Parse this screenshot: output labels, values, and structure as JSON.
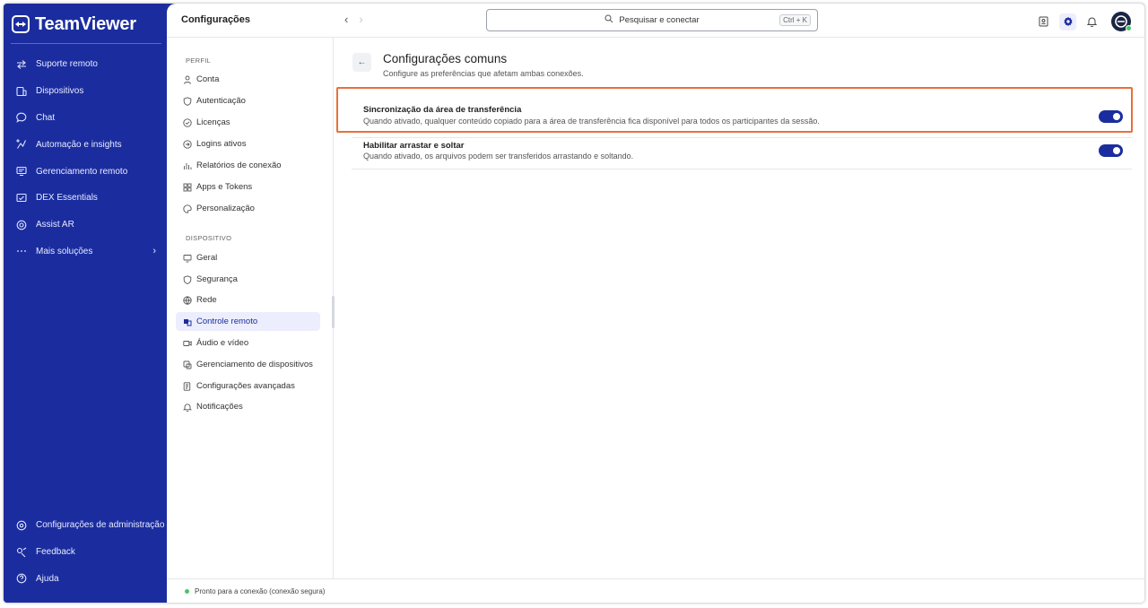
{
  "brand": {
    "name": "TeamViewer"
  },
  "sidebar": {
    "items": [
      {
        "label": "Suporte remoto",
        "icon": "arrows-swap-icon"
      },
      {
        "label": "Dispositivos",
        "icon": "devices-icon"
      },
      {
        "label": "Chat",
        "icon": "chat-icon"
      },
      {
        "label": "Automação e insights",
        "icon": "automation-icon"
      },
      {
        "label": "Gerenciamento remoto",
        "icon": "remote-management-icon"
      },
      {
        "label": "DEX Essentials",
        "icon": "dex-icon"
      },
      {
        "label": "Assist AR",
        "icon": "assist-ar-icon"
      },
      {
        "label": "Mais soluções",
        "icon": "more-dots-icon"
      }
    ],
    "bottom": [
      {
        "label": "Configurações de administração",
        "icon": "admin-settings-icon"
      },
      {
        "label": "Feedback",
        "icon": "feedback-icon"
      },
      {
        "label": "Ajuda",
        "icon": "help-icon"
      }
    ]
  },
  "header": {
    "title": "Configurações",
    "search_placeholder": "Pesquisar e conectar",
    "search_shortcut": "Ctrl + K"
  },
  "settings_nav": {
    "profile_label": "PERFIL",
    "profile_items": [
      {
        "label": "Conta",
        "icon": "user-icon"
      },
      {
        "label": "Autenticação",
        "icon": "shield-icon"
      },
      {
        "label": "Licenças",
        "icon": "check-circle-icon"
      },
      {
        "label": "Logins ativos",
        "icon": "login-icon"
      },
      {
        "label": "Relatórios de conexão",
        "icon": "bar-chart-icon"
      },
      {
        "label": "Apps e Tokens",
        "icon": "apps-icon"
      },
      {
        "label": "Personalização",
        "icon": "palette-icon"
      }
    ],
    "device_label": "DISPOSITIVO",
    "device_items": [
      {
        "label": "Geral",
        "icon": "monitor-icon"
      },
      {
        "label": "Segurança",
        "icon": "shield-icon"
      },
      {
        "label": "Rede",
        "icon": "globe-icon"
      },
      {
        "label": "Controle remoto",
        "icon": "remote-control-icon",
        "active": true
      },
      {
        "label": "Áudio e vídeo",
        "icon": "video-camera-icon"
      },
      {
        "label": "Gerenciamento de dispositivos",
        "icon": "device-management-icon"
      },
      {
        "label": "Configurações avançadas",
        "icon": "advanced-settings-icon"
      },
      {
        "label": "Notificações",
        "icon": "bell-icon"
      }
    ]
  },
  "content": {
    "title": "Configurações comuns",
    "subtitle": "Configure as preferências que afetam ambas conexões.",
    "settings": [
      {
        "title": "Sincronização da área de transferência",
        "description": "Quando ativado, qualquer conteúdo copiado para a área de transferência fica disponível para todos os participantes da sessão.",
        "enabled": true,
        "highlighted": true
      },
      {
        "title": "Habilitar arrastar e soltar",
        "description": "Quando ativado, os arquivos podem ser transferidos arrastando e soltando.",
        "enabled": true,
        "highlighted": false
      }
    ]
  },
  "status": {
    "text": "Pronto para a conexão (conexão segura)"
  },
  "colors": {
    "sidebar": "#1b2d9e",
    "accent": "#1b2d9e",
    "highlight": "#e8703a",
    "online": "#48c760"
  }
}
